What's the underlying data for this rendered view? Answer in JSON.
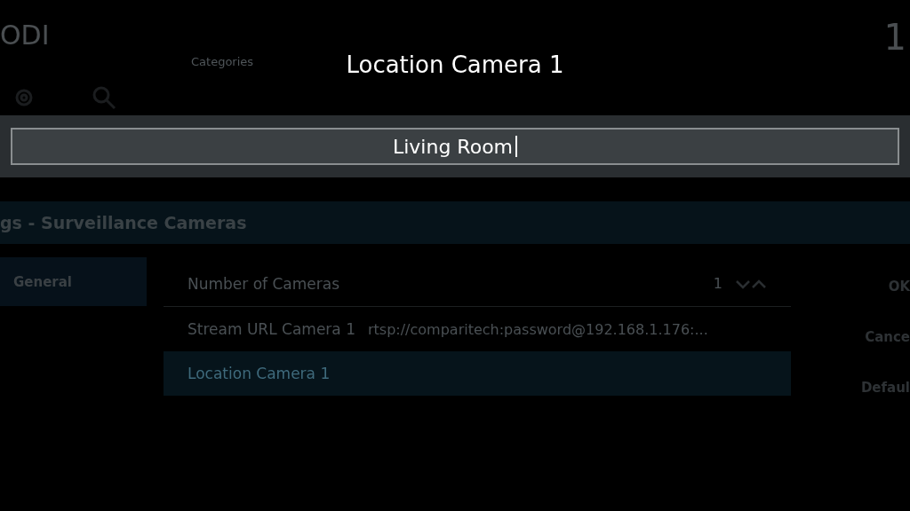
{
  "background": {
    "logo": "ODI",
    "tab": "Categories",
    "clock": "1"
  },
  "dialog": {
    "title": "Location Camera 1",
    "value": "Living Room"
  },
  "settings": {
    "title": "gs - Surveillance Cameras",
    "categories": [
      {
        "label": "General",
        "selected": true
      }
    ],
    "rows": [
      {
        "kind": "spinner",
        "label": "Number of Cameras",
        "value": "1",
        "selected": false
      },
      {
        "kind": "text",
        "label": "Stream URL Camera 1",
        "value": "rtsp://comparitech:password@192.168.1.176:...",
        "selected": false
      },
      {
        "kind": "text",
        "label": "Location Camera 1",
        "selected": true
      }
    ],
    "buttons": [
      "OK",
      "Cance",
      "Defaul"
    ]
  }
}
